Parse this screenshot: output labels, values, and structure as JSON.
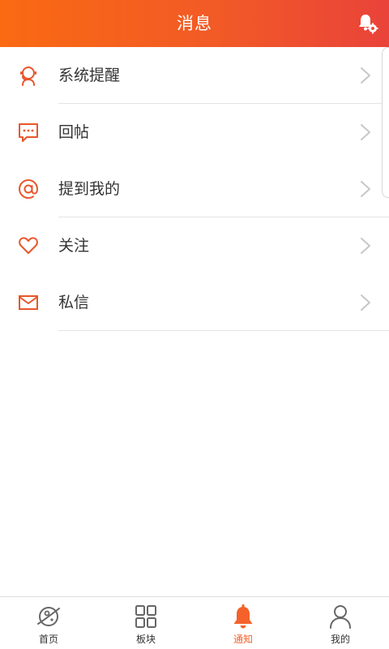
{
  "header": {
    "title": "消息",
    "settings_icon": "bell-settings-icon"
  },
  "menu": {
    "items": [
      {
        "label": "系统提醒",
        "icon": "headset-icon"
      },
      {
        "label": "回帖",
        "icon": "chat-bubble-icon"
      },
      {
        "label": "提到我的",
        "icon": "at-sign-icon"
      },
      {
        "label": "关注",
        "icon": "heart-icon"
      },
      {
        "label": "私信",
        "icon": "envelope-icon"
      }
    ]
  },
  "tabbar": {
    "items": [
      {
        "label": "首页",
        "icon": "planet-icon",
        "active": false
      },
      {
        "label": "板块",
        "icon": "grid-icon",
        "active": false
      },
      {
        "label": "通知",
        "icon": "bell-icon",
        "active": true
      },
      {
        "label": "我的",
        "icon": "person-icon",
        "active": false
      }
    ]
  },
  "colors": {
    "accent": "#f4622a",
    "header_gradient_start": "#f96a12",
    "header_gradient_end": "#e9433a",
    "text": "#333333",
    "divider": "#e4e4e4",
    "chevron": "#c7c7c7",
    "tab_inactive": "#666666"
  }
}
